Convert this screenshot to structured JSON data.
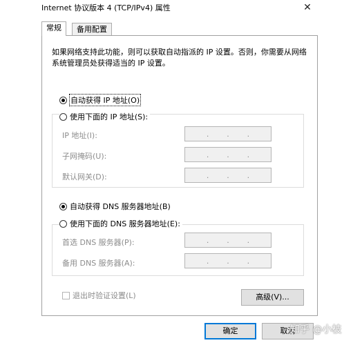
{
  "window": {
    "title": "Internet 协议版本 4 (TCP/IPv4) 属性",
    "close_glyph": "✕"
  },
  "tabs": [
    {
      "label": "常规",
      "active": true
    },
    {
      "label": "备用配置",
      "active": false
    }
  ],
  "description": "如果网络支持此功能，则可以获取自动指派的 IP 设置。否则，你需要从网络系统管理员处获得适当的 IP 设置。",
  "ip_section": {
    "auto_label": "自动获得 IP 地址(O)",
    "auto_checked": true,
    "manual_label": "使用下面的 IP 地址(S):",
    "manual_checked": false,
    "fields": [
      {
        "label": "IP 地址(I):"
      },
      {
        "label": "子网掩码(U):"
      },
      {
        "label": "默认网关(D):"
      }
    ]
  },
  "dns_section": {
    "auto_label": "自动获得 DNS 服务器地址(B)",
    "auto_checked": true,
    "manual_label": "使用下面的 DNS 服务器地址(E):",
    "manual_checked": false,
    "fields": [
      {
        "label": "首选 DNS 服务器(P):"
      },
      {
        "label": "备用 DNS 服务器(A):"
      }
    ]
  },
  "ip_dot": ".",
  "validate_checkbox": {
    "label": "退出时验证设置(L)",
    "checked": false,
    "enabled": false
  },
  "buttons": {
    "advanced": "高级(V)...",
    "ok": "确定",
    "cancel": "取消"
  },
  "watermark": "知乎 @小枝"
}
